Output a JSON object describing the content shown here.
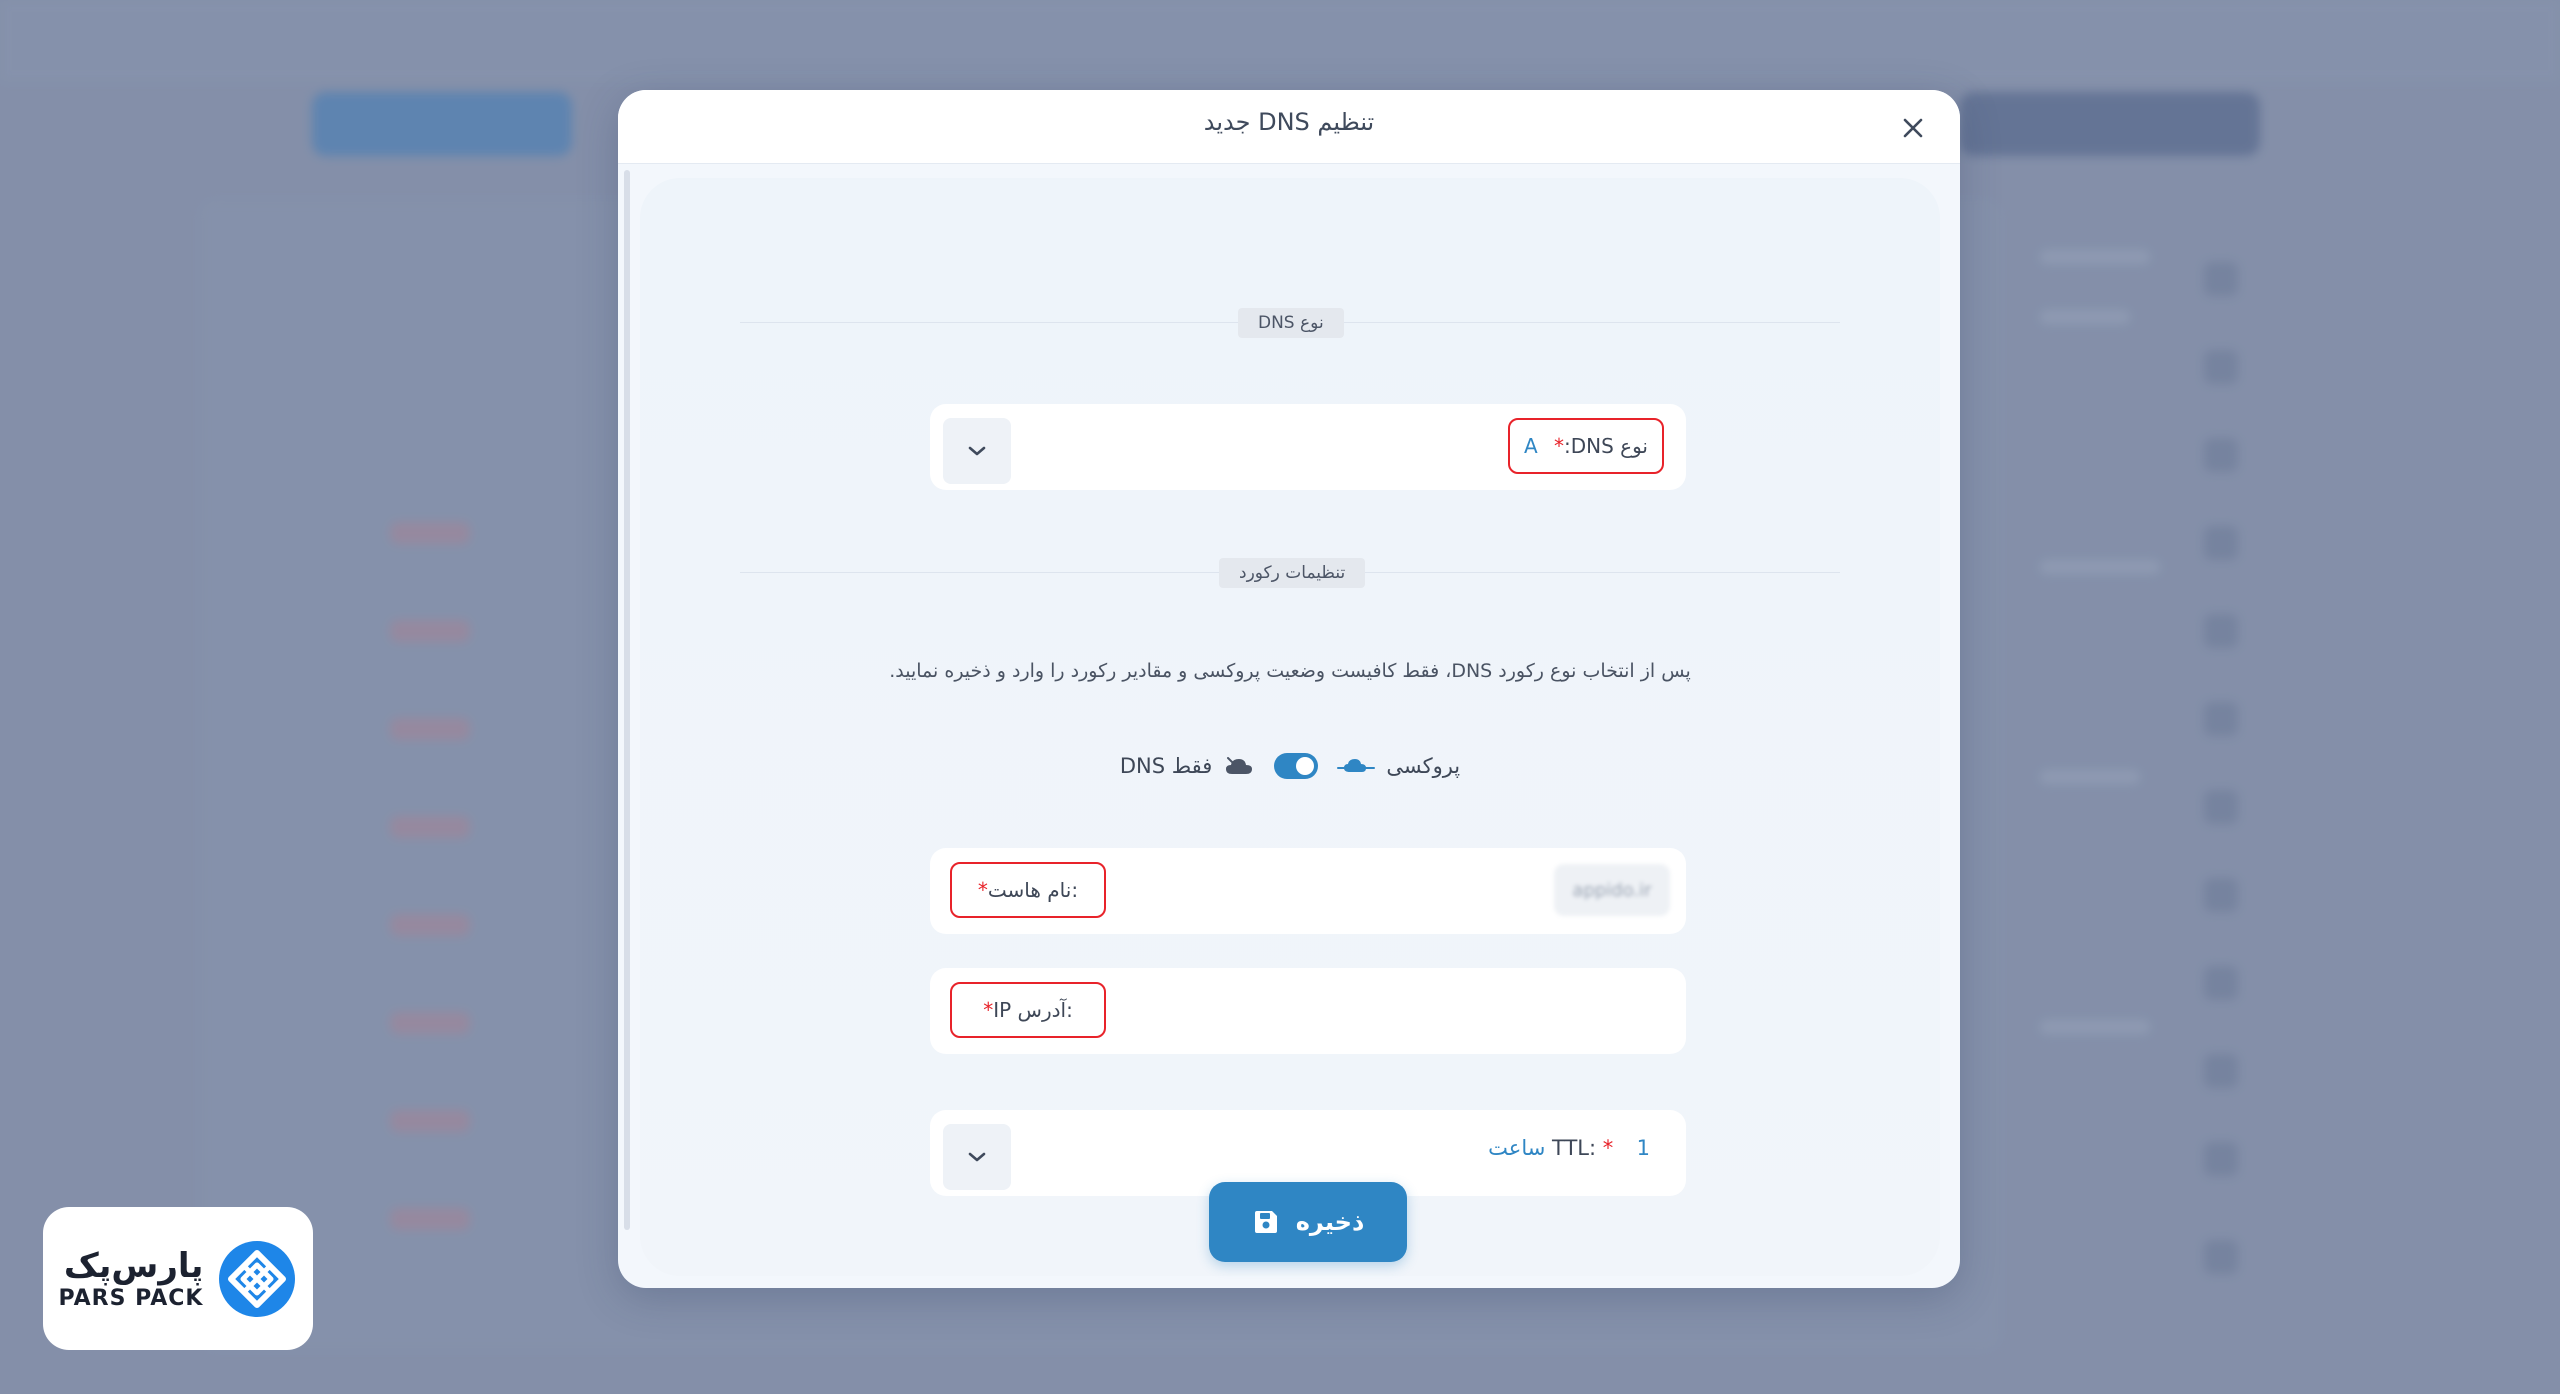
{
  "modal": {
    "title": "تنظیم DNS جدید"
  },
  "sections": {
    "dns_type": "نوع DNS",
    "record_settings": "تنظیمات رکورد"
  },
  "fields": {
    "dns_type": {
      "label": "نوع DNS:",
      "required_mark": "*",
      "value": "A"
    },
    "host_name": {
      "label": ":نام هاست",
      "required_mark": "*",
      "suffix": "appido.ir"
    },
    "ip_address": {
      "label": ":آدرس IP",
      "required_mark": "*"
    },
    "ttl": {
      "label": "TTL:",
      "required_mark": "*",
      "value": "1 ساعت"
    }
  },
  "helper_text": "پس از انتخاب نوع رکورد DNS، فقط کافیست وضعیت پروکسی و مقادیر رکورد را وارد و ذخیره نمایید.",
  "proxy": {
    "proxy_label": "پروکسی",
    "dns_only_label": "فقط DNS",
    "enabled": true
  },
  "save_button": {
    "label": "ذخیره"
  },
  "brand": {
    "name_fa": "پارس‌پک",
    "name_en": "PARS PACK"
  },
  "colors": {
    "accent": "#2f86c4",
    "required": "#e8232a",
    "overlay": "#8a96ae"
  }
}
